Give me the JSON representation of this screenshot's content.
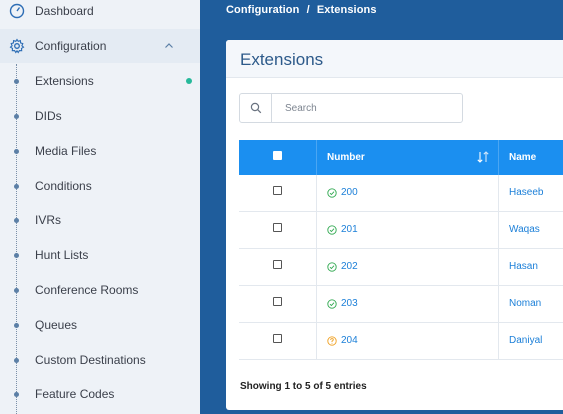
{
  "sidebar": {
    "dashboard": "Dashboard",
    "configuration": "Configuration",
    "items": [
      {
        "label": "Extensions",
        "active": true
      },
      {
        "label": "DIDs"
      },
      {
        "label": "Media Files"
      },
      {
        "label": "Conditions"
      },
      {
        "label": "IVRs"
      },
      {
        "label": "Hunt Lists"
      },
      {
        "label": "Conference Rooms"
      },
      {
        "label": "Queues"
      },
      {
        "label": "Custom Destinations"
      },
      {
        "label": "Feature Codes"
      }
    ]
  },
  "breadcrumb": {
    "root": "Configuration",
    "sep": "/",
    "current": "Extensions"
  },
  "page": {
    "title": "Extensions"
  },
  "search": {
    "placeholder": "Search",
    "value": ""
  },
  "table": {
    "columns": {
      "number": "Number",
      "name": "Name"
    },
    "rows": [
      {
        "number": "200",
        "name": "Haseeb",
        "status": "ok"
      },
      {
        "number": "201",
        "name": "Waqas",
        "status": "ok"
      },
      {
        "number": "202",
        "name": "Hasan",
        "status": "ok"
      },
      {
        "number": "203",
        "name": "Noman",
        "status": "ok"
      },
      {
        "number": "204",
        "name": "Daniyal",
        "status": "unknown"
      }
    ]
  },
  "footer": {
    "entries": "Showing 1 to 5 of 5 entries"
  },
  "colors": {
    "accent": "#1b8ff0",
    "header_bg": "#1f5d9c",
    "ok": "#2fa84f",
    "warn": "#f0a020",
    "active_dot": "#26b99a"
  }
}
